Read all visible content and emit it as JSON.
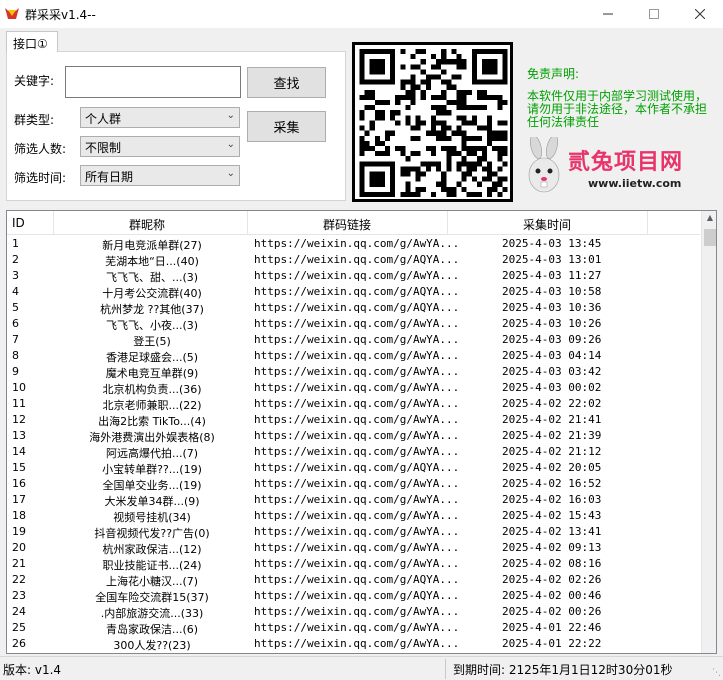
{
  "window": {
    "title": "群采采v1.4--"
  },
  "tab": {
    "label": "接口①"
  },
  "form": {
    "keyword_label": "关键字:",
    "keyword_value": "",
    "group_type_label": "群类型:",
    "group_type_value": "个人群",
    "member_filter_label": "筛选人数:",
    "member_filter_value": "不限制",
    "time_filter_label": "筛选时间:",
    "time_filter_value": "所有日期",
    "search_button": "查找",
    "collect_button": "采集"
  },
  "disclaimer": {
    "title": "免责声明:",
    "text": "本软件仅用于内部学习测试使用，请勿用于非法途径，本作者不承担任何法律责任"
  },
  "logo": {
    "text": "贰兔项目网",
    "url": "www.iietw.com"
  },
  "colors": {
    "disclaimer_green": "#00a000",
    "logo_pink": "#e8336b"
  },
  "table": {
    "headers": {
      "id": "ID",
      "name": "群昵称",
      "link": "群码链接",
      "time": "采集时间"
    },
    "rows": [
      {
        "id": "1",
        "name": "新月电竞派单群(27)",
        "link": "https://weixin.qq.com/g/AwYA...",
        "time": "2025-4-03 13:45"
      },
      {
        "id": "2",
        "name": "芜湖本地“日...(40)",
        "link": "https://weixin.qq.com/g/AQYA...",
        "time": "2025-4-03 13:01"
      },
      {
        "id": "3",
        "name": "飞飞飞、甜、...(3)",
        "link": "https://weixin.qq.com/g/AwYA...",
        "time": "2025-4-03 11:27"
      },
      {
        "id": "4",
        "name": "十月考公交流群(40)",
        "link": "https://weixin.qq.com/g/AQYA...",
        "time": "2025-4-03 10:58"
      },
      {
        "id": "5",
        "name": "杭州梦龙 ??其他(37)",
        "link": "https://weixin.qq.com/g/AQYA...",
        "time": "2025-4-03 10:36"
      },
      {
        "id": "6",
        "name": "飞飞飞、小夜...(3)",
        "link": "https://weixin.qq.com/g/AwYA...",
        "time": "2025-4-03 10:26"
      },
      {
        "id": "7",
        "name": "登王(5)",
        "link": "https://weixin.qq.com/g/AwYA...",
        "time": "2025-4-03 09:26"
      },
      {
        "id": "8",
        "name": "香港足球盛会...(5)",
        "link": "https://weixin.qq.com/g/AwYA...",
        "time": "2025-4-03 04:14"
      },
      {
        "id": "9",
        "name": "魔术电竞互单群(9)",
        "link": "https://weixin.qq.com/g/AwYA...",
        "time": "2025-4-03 03:42"
      },
      {
        "id": "10",
        "name": "北京机构负责...(36)",
        "link": "https://weixin.qq.com/g/AwYA...",
        "time": "2025-4-03 00:02"
      },
      {
        "id": "11",
        "name": "北京老师兼职...(22)",
        "link": "https://weixin.qq.com/g/AwYA...",
        "time": "2025-4-02 22:02"
      },
      {
        "id": "12",
        "name": "出海2比索 TikTo...(4)",
        "link": "https://weixin.qq.com/g/AwYA...",
        "time": "2025-4-02 21:41"
      },
      {
        "id": "13",
        "name": "海外港费演出外娱表格(8)",
        "link": "https://weixin.qq.com/g/AwYA...",
        "time": "2025-4-02 21:39"
      },
      {
        "id": "14",
        "name": "阿远高爆代拍...(7)",
        "link": "https://weixin.qq.com/g/AwYA...",
        "time": "2025-4-02 21:12"
      },
      {
        "id": "15",
        "name": "小宝转单群??...(19)",
        "link": "https://weixin.qq.com/g/AQYA...",
        "time": "2025-4-02 20:05"
      },
      {
        "id": "16",
        "name": "全国单交业务...(19)",
        "link": "https://weixin.qq.com/g/AwYA...",
        "time": "2025-4-02 16:52"
      },
      {
        "id": "17",
        "name": "大米发单34群...(9)",
        "link": "https://weixin.qq.com/g/AwYA...",
        "time": "2025-4-02 16:03"
      },
      {
        "id": "18",
        "name": "视频号挂机(34)",
        "link": "https://weixin.qq.com/g/AwYA...",
        "time": "2025-4-02 15:43"
      },
      {
        "id": "19",
        "name": "抖音视频代发??广告(0)",
        "link": "https://weixin.qq.com/g/AwYA...",
        "time": "2025-4-02 13:41"
      },
      {
        "id": "20",
        "name": "杭州家政保洁...(12)",
        "link": "https://weixin.qq.com/g/AwYA...",
        "time": "2025-4-02 09:13"
      },
      {
        "id": "21",
        "name": "职业技能证书...(24)",
        "link": "https://weixin.qq.com/g/AwYA...",
        "time": "2025-4-02 08:16"
      },
      {
        "id": "22",
        "name": "上海花小糖汉...(7)",
        "link": "https://weixin.qq.com/g/AQYA...",
        "time": "2025-4-02 02:26"
      },
      {
        "id": "23",
        "name": "全国车险交流群15(37)",
        "link": "https://weixin.qq.com/g/AQYA...",
        "time": "2025-4-02 00:46"
      },
      {
        "id": "24",
        "name": ".内部旅游交流...(33)",
        "link": "https://weixin.qq.com/g/AwYA...",
        "time": "2025-4-02 00:26"
      },
      {
        "id": "25",
        "name": "青岛家政保洁...(6)",
        "link": "https://weixin.qq.com/g/AwYA...",
        "time": "2025-4-01 22:46"
      },
      {
        "id": "26",
        "name": "300人发??(23)",
        "link": "https://weixin.qq.com/g/AwYA...",
        "time": "2025-4-01 22:22"
      }
    ]
  },
  "status": {
    "version": "版本: v1.4",
    "expiry": "到期时间: 2125年1月1日12时30分01秒"
  }
}
